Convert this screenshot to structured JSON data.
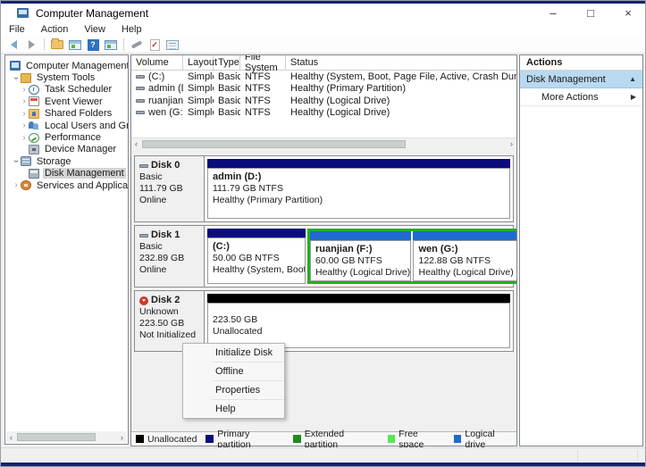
{
  "window": {
    "title": "Computer Management",
    "controls": {
      "minimize": "–",
      "maximize": "□",
      "close": "×"
    }
  },
  "menubar": {
    "items": [
      "File",
      "Action",
      "View",
      "Help"
    ]
  },
  "toolbar": {
    "help_glyph": "?",
    "check_glyph": "✓"
  },
  "tree": {
    "items": [
      {
        "label": "Computer Management (Local"
      },
      {
        "label": "System Tools"
      },
      {
        "label": "Task Scheduler"
      },
      {
        "label": "Event Viewer"
      },
      {
        "label": "Shared Folders"
      },
      {
        "label": "Local Users and Groups"
      },
      {
        "label": "Performance"
      },
      {
        "label": "Device Manager"
      },
      {
        "label": "Storage"
      },
      {
        "label": "Disk Management"
      },
      {
        "label": "Services and Applications"
      }
    ]
  },
  "volumes": {
    "headers": [
      "Volume",
      "Layout",
      "Type",
      "File System",
      "Status"
    ],
    "rows": [
      {
        "volume": "(C:)",
        "layout": "Simple",
        "type": "Basic",
        "fs": "NTFS",
        "status": "Healthy (System, Boot, Page File, Active, Crash Dump, Primary P"
      },
      {
        "volume": "admin (D:)",
        "layout": "Simple",
        "type": "Basic",
        "fs": "NTFS",
        "status": "Healthy (Primary Partition)"
      },
      {
        "volume": "ruanjian (F:)",
        "layout": "Simple",
        "type": "Basic",
        "fs": "NTFS",
        "status": "Healthy (Logical Drive)"
      },
      {
        "volume": "wen (G:)",
        "layout": "Simple",
        "type": "Basic",
        "fs": "NTFS",
        "status": "Healthy (Logical Drive)"
      }
    ]
  },
  "disks": [
    {
      "name": "Disk 0",
      "type": "Basic",
      "size": "111.79 GB",
      "status": "Online",
      "partitions": [
        {
          "name": "admin  (D:)",
          "size": "111.79 GB NTFS",
          "status": "Healthy (Primary Partition)",
          "color": "#0b0b7d"
        }
      ]
    },
    {
      "name": "Disk 1",
      "type": "Basic",
      "size": "232.89 GB",
      "status": "Online",
      "partitions": [
        {
          "name": "(C:)",
          "size": "50.00 GB NTFS",
          "status": "Healthy (System, Boot, Pa",
          "color": "#0b0b7d"
        },
        {
          "name": "ruanjian  (F:)",
          "size": "60.00 GB NTFS",
          "status": "Healthy (Logical Drive)",
          "color": "#1f6bd0"
        },
        {
          "name": "wen  (G:)",
          "size": "122.88 GB NTFS",
          "status": "Healthy (Logical Drive)",
          "color": "#1f6bd0"
        }
      ]
    },
    {
      "name": "Disk 2",
      "type": "Unknown",
      "size": "223.50 GB",
      "status": "Not Initialized",
      "partitions": [
        {
          "name": "",
          "size": "223.50 GB",
          "status": "Unallocated",
          "color": "#000000"
        }
      ]
    }
  ],
  "context_menu": {
    "items": [
      "Initialize Disk",
      "Offline",
      "Properties",
      "Help"
    ]
  },
  "actions": {
    "title": "Actions",
    "group": "Disk Management",
    "group_caret": "▲",
    "more": "More Actions",
    "more_caret": "▶"
  },
  "legend": {
    "items": [
      {
        "label": "Unallocated",
        "color": "#000000"
      },
      {
        "label": "Primary partition",
        "color": "#0b0b7d"
      },
      {
        "label": "Extended partition",
        "color": "#1e8c1e"
      },
      {
        "label": "Free space",
        "color": "#59e559"
      },
      {
        "label": "Logical drive",
        "color": "#1f6bd0"
      }
    ]
  },
  "scroll": {
    "left": "‹",
    "right": "›"
  },
  "tree_chevrons": {
    "collapsed": "›",
    "expanded": "›"
  }
}
